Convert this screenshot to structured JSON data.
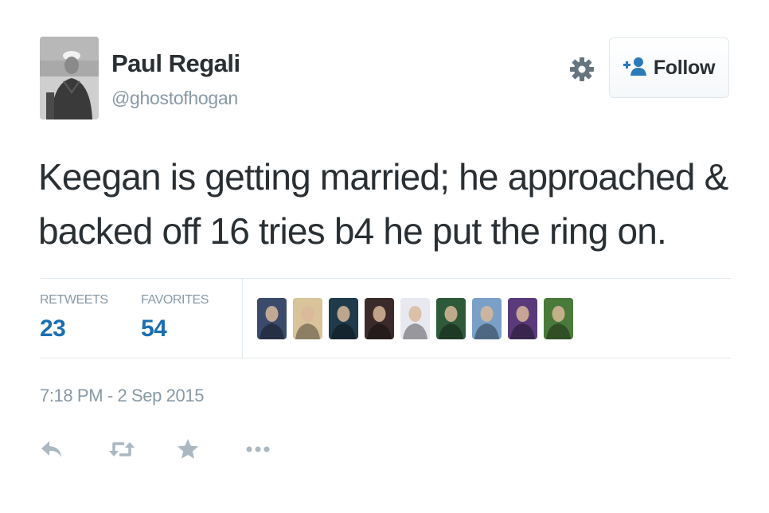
{
  "author": {
    "name": "Paul Regali",
    "handle": "@ghostofhogan"
  },
  "follow_button": {
    "label": "Follow",
    "icon": "add-user-icon"
  },
  "settings": {
    "icon": "gear-icon"
  },
  "tweet": {
    "text_line_1": "Keegan is getting married; he approached &",
    "text_line_2": "backed off 16 tries b4 he put the ring on."
  },
  "stats": {
    "retweets_label": "RETWEETS",
    "retweets_value": "23",
    "favorites_label": "FAVORITES",
    "favorites_value": "54"
  },
  "favorited_by_avatars": [
    {
      "icon": "user-avatar-1",
      "color": "#3a4a6a"
    },
    {
      "icon": "user-avatar-2",
      "color": "#d9c39a"
    },
    {
      "icon": "user-avatar-3",
      "color": "#1f3a4a"
    },
    {
      "icon": "user-avatar-4",
      "color": "#3b2a2a"
    },
    {
      "icon": "user-avatar-5",
      "color": "#e8e8f0"
    },
    {
      "icon": "user-avatar-6",
      "color": "#2e5a3a"
    },
    {
      "icon": "user-avatar-7",
      "color": "#7aa0c8"
    },
    {
      "icon": "user-avatar-8",
      "color": "#5a3a7a"
    },
    {
      "icon": "user-avatar-9",
      "color": "#4a7a3a"
    }
  ],
  "timestamp": "7:18 PM - 2 Sep 2015",
  "actions": [
    {
      "icon": "reply-icon"
    },
    {
      "icon": "retweet-icon"
    },
    {
      "icon": "favorite-star-icon"
    },
    {
      "icon": "more-icon"
    }
  ],
  "colors": {
    "text": "#292f33",
    "muted": "#8899a6",
    "stat_value": "#1b6fb0",
    "follow_icon": "#2b7bb9",
    "divider": "#e1e8ed"
  }
}
